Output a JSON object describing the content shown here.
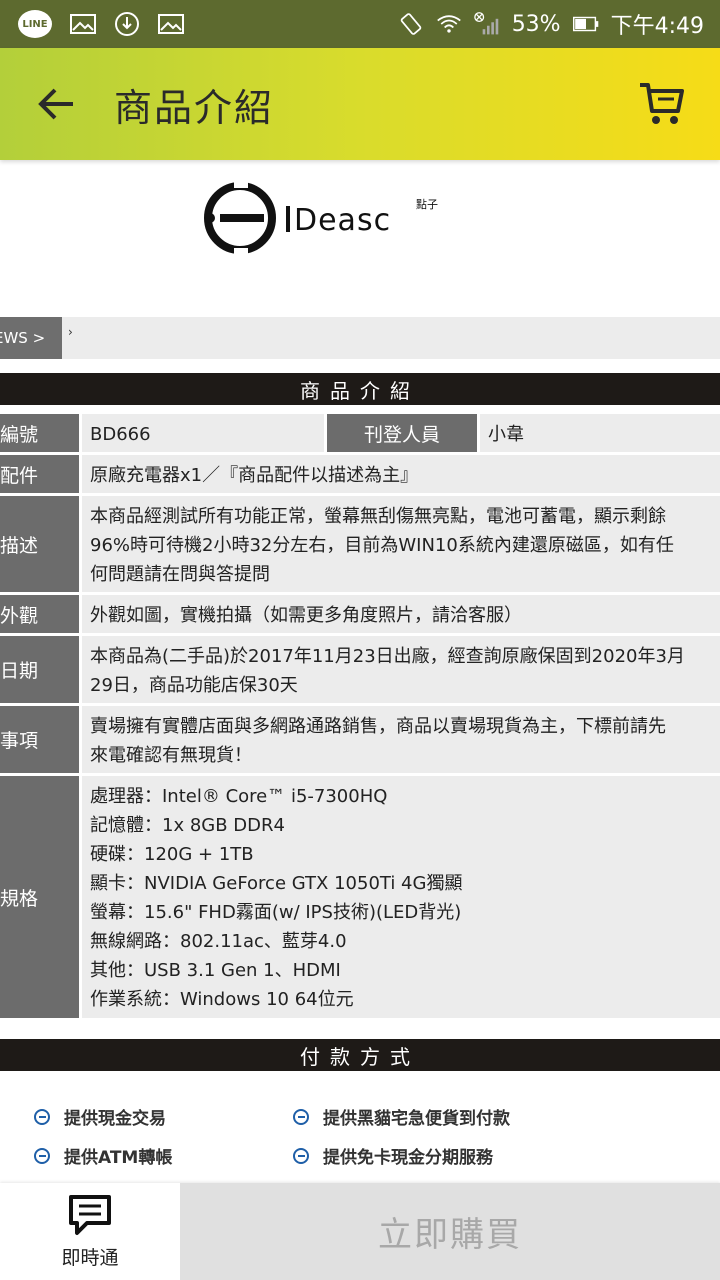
{
  "status_bar": {
    "line_label": "LINE",
    "battery_pct": "53%",
    "time": "下午4:49"
  },
  "app_bar": {
    "title": "商品介紹"
  },
  "logo": {
    "text": "IDEA3C",
    "sub": "點子"
  },
  "breadcrumb": {
    "tab_label": "EWS >",
    "separator": "›"
  },
  "product_section": {
    "title": "商品介紹",
    "rows": [
      {
        "label": "編號",
        "value": "BD666",
        "extra_label": "刊登人員",
        "extra_value": "小韋"
      },
      {
        "label": "配件",
        "value": "原廠充電器x1／『商品配件以描述為主』"
      },
      {
        "label": "描述",
        "lines": [
          "本商品經測試所有功能正常，螢幕無刮傷無亮點，電池可蓄電，顯示剩餘",
          "96%時可待機2小時32分左右，目前為WIN10系統內建還原磁區，如有任",
          "何問題請在問與答提問"
        ]
      },
      {
        "label": "外觀",
        "value": "外觀如圖，實機拍攝（如需更多角度照片，請洽客服）"
      },
      {
        "label": "日期",
        "lines": [
          "本商品為(二手品)於2017年11月23日出廠，經查詢原廠保固到2020年3月",
          "29日，商品功能店保30天"
        ]
      },
      {
        "label": "事項",
        "lines": [
          "賣場擁有實體店面與多網路通路銷售，商品以賣場現貨為主，下標前請先",
          "來電確認有無現貨！"
        ]
      },
      {
        "label": "規格",
        "lines": [
          "處理器：Intel® Core™ i5-7300HQ",
          "記憶體：1x 8GB DDR4",
          "硬碟：120G + 1TB",
          "顯卡：NVIDIA GeForce GTX 1050Ti 4G獨顯",
          "螢幕：15.6\" FHD霧面(w/ IPS技術)(LED背光)",
          "無線網路：802.11ac、藍芽4.0",
          "其他：USB 3.1 Gen 1、HDMI",
          "作業系統：Windows 10 64位元"
        ]
      }
    ]
  },
  "payment_section": {
    "title": "付款方式",
    "items": [
      "提供現金交易",
      "提供黑貓宅急便貨到付款",
      "提供ATM轉帳",
      "提供免卡現金分期服務"
    ]
  },
  "bottom_bar": {
    "chat_label": "即時通",
    "buy_label": "立即購買"
  },
  "colors": {
    "appbar_start": "#b3cf3a",
    "appbar_end": "#f6dc17",
    "section_header": "#1e1a17",
    "label_bg": "#6c6c6c",
    "value_bg": "#ececec",
    "pay_icon": "#1f5fa8"
  }
}
